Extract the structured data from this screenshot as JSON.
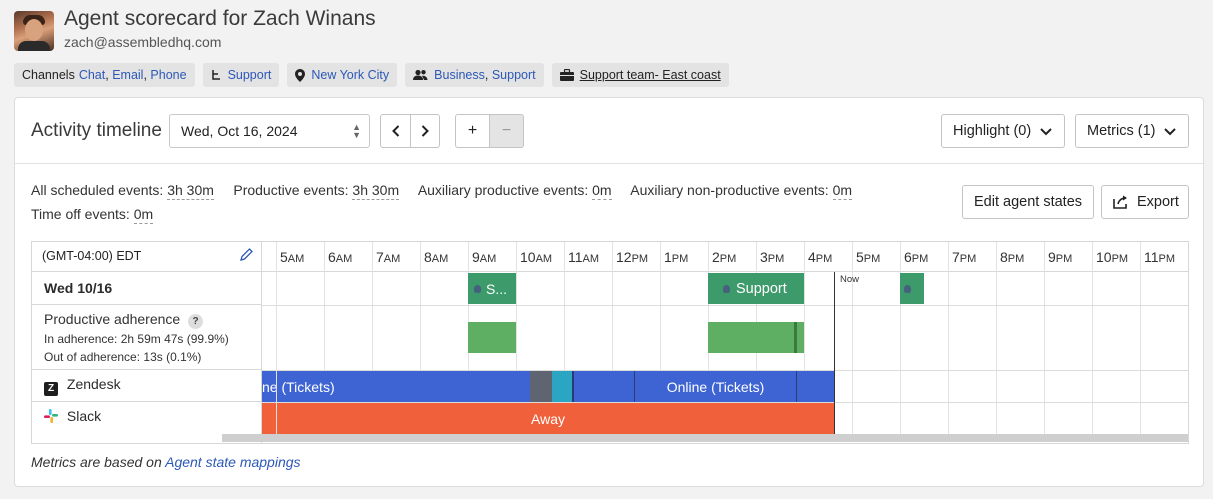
{
  "header": {
    "title": "Agent scorecard for Zach Winans",
    "email": "zach@assembledhq.com"
  },
  "chips": {
    "channels_label": "Channels",
    "channels": [
      "Chat",
      "Email",
      "Phone"
    ],
    "queue": "Support",
    "location": "New York City",
    "skills": [
      "Business",
      "Support"
    ],
    "team": "Support team- East coast"
  },
  "toolbar": {
    "label": "Activity timeline",
    "date": "Wed, Oct 16, 2024",
    "prev": "‹",
    "next": "›",
    "zoom_in": "+",
    "zoom_out": "−",
    "highlight": "Highlight (0)",
    "metrics": "Metrics (1)"
  },
  "summary": {
    "scheduled_label": "All scheduled events:",
    "scheduled_value": "3h 30m",
    "productive_label": "Productive events:",
    "productive_value": "3h 30m",
    "aux_prod_label": "Auxiliary productive events:",
    "aux_prod_value": "0m",
    "aux_nonprod_label": "Auxiliary non-productive events:",
    "aux_nonprod_value": "0m",
    "timeoff_label": "Time off events:",
    "timeoff_value": "0m",
    "edit_button": "Edit agent states",
    "export_button": "Export"
  },
  "timeline": {
    "timezone": "(GMT-04:00) EDT",
    "day_label": "Wed 10/16",
    "adherence_label": "Productive adherence",
    "adherence_help": "?",
    "in_adherence": "In adherence: 2h 59m 47s  (99.9%)",
    "out_adherence": "Out of adherence: 13s  (0.1%)",
    "zendesk_label": "Zendesk",
    "slack_label": "Slack",
    "now_label": "Now",
    "hours": [
      {
        "n": "5",
        "s": "AM"
      },
      {
        "n": "6",
        "s": "AM"
      },
      {
        "n": "7",
        "s": "AM"
      },
      {
        "n": "8",
        "s": "AM"
      },
      {
        "n": "9",
        "s": "AM"
      },
      {
        "n": "10",
        "s": "AM"
      },
      {
        "n": "11",
        "s": "AM"
      },
      {
        "n": "12",
        "s": "PM"
      },
      {
        "n": "1",
        "s": "PM"
      },
      {
        "n": "2",
        "s": "PM"
      },
      {
        "n": "3",
        "s": "PM"
      },
      {
        "n": "4",
        "s": "PM"
      },
      {
        "n": "5",
        "s": "PM"
      },
      {
        "n": "6",
        "s": "PM"
      },
      {
        "n": "7",
        "s": "PM"
      },
      {
        "n": "8",
        "s": "PM"
      },
      {
        "n": "9",
        "s": "PM"
      },
      {
        "n": "10",
        "s": "PM"
      },
      {
        "n": "11",
        "s": "PM"
      }
    ],
    "events": [
      {
        "label": "S...",
        "color": "#3d9a6a"
      },
      {
        "label": "Support",
        "color": "#3d9a6a"
      },
      {
        "label": "",
        "color": "#3d9a6a"
      }
    ],
    "zendesk_segments": [
      {
        "label": "ne (Tickets)",
        "color": "#3e63d3"
      },
      {
        "label": "Online (Tickets)",
        "color": "#3e63d3"
      }
    ],
    "slack_segments": [
      {
        "label": "Away",
        "color": "#f0603a"
      }
    ]
  },
  "footer": {
    "text": "Metrics are based on",
    "link": "Agent state mappings"
  }
}
